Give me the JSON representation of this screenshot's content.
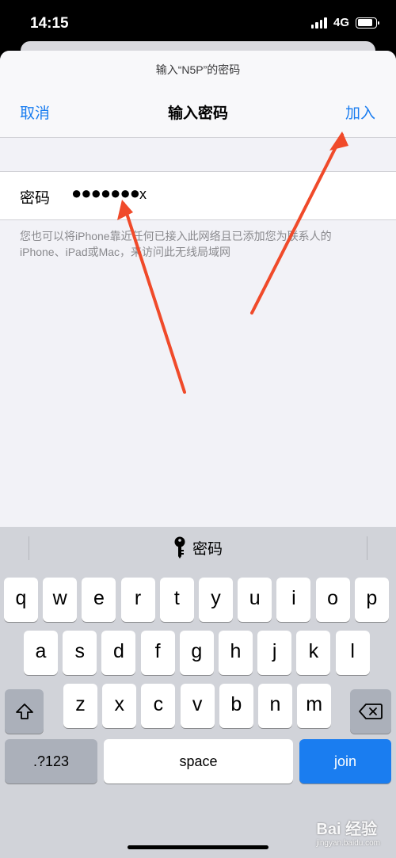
{
  "status": {
    "time": "14:15",
    "network": "4G",
    "battery_level": 0.85
  },
  "sheet": {
    "prompt": "输入“N5P”的密码",
    "cancel_label": "取消",
    "title": "输入密码",
    "join_label": "加入"
  },
  "password_field": {
    "label": "密码",
    "dots": "●●●●●●●",
    "last_char": "x"
  },
  "hint": "您也可以将iPhone靠近任何已接入此网络且已添加您为联系人的iPhone、iPad或Mac，来访问此无线局域网",
  "keyboard": {
    "suggestion": "密码",
    "suggestion_icon": "key-icon",
    "row1": [
      "q",
      "w",
      "e",
      "r",
      "t",
      "y",
      "u",
      "i",
      "o",
      "p"
    ],
    "row2": [
      "a",
      "s",
      "d",
      "f",
      "g",
      "h",
      "j",
      "k",
      "l"
    ],
    "row3": [
      "z",
      "x",
      "c",
      "v",
      "b",
      "n",
      "m"
    ],
    "shift_icon": "shift-icon",
    "delete_icon": "delete-icon",
    "numbers_label": ".?123",
    "space_label": "space",
    "join_label": "join"
  },
  "colors": {
    "accent": "#1a7df0",
    "arrow": "#f04a2a"
  },
  "watermark": {
    "brand": "Bai 经验",
    "site": "jingyan.baidu.com"
  }
}
